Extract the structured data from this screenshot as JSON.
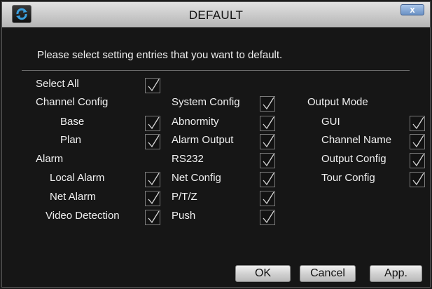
{
  "dialog": {
    "title": "DEFAULT",
    "close_label": "x",
    "logo_icon": "refresh-icon",
    "instruction": "Please select setting entries that you want to default."
  },
  "options": {
    "select_all": {
      "label": "Select All",
      "checked": true
    },
    "column1": [
      {
        "label": "Channel Config",
        "checked": null
      },
      {
        "label": "Base",
        "checked": true
      },
      {
        "label": "Plan",
        "checked": true
      },
      {
        "label": "Alarm",
        "checked": null
      },
      {
        "label": "Local Alarm",
        "checked": true
      },
      {
        "label": "Net Alarm",
        "checked": true
      },
      {
        "label": "Video Detection",
        "checked": true
      }
    ],
    "column2": [
      {
        "label": "System Config",
        "checked": true
      },
      {
        "label": "Abnormity",
        "checked": true
      },
      {
        "label": "Alarm Output",
        "checked": true
      },
      {
        "label": "RS232",
        "checked": true
      },
      {
        "label": "Net Config",
        "checked": true
      },
      {
        "label": "P/T/Z",
        "checked": true
      },
      {
        "label": "Push",
        "checked": true
      }
    ],
    "column3": [
      {
        "label": "Output Mode",
        "checked": null
      },
      {
        "label": "GUI",
        "checked": true
      },
      {
        "label": "Channel Name",
        "checked": true
      },
      {
        "label": "Output Config",
        "checked": true
      },
      {
        "label": "Tour Config",
        "checked": true
      }
    ]
  },
  "buttons": {
    "ok": "OK",
    "cancel": "Cancel",
    "apply": "App."
  },
  "colors": {
    "background": "#161616",
    "titlebar": "#c9c9c9",
    "text": "#f0f0f0"
  }
}
